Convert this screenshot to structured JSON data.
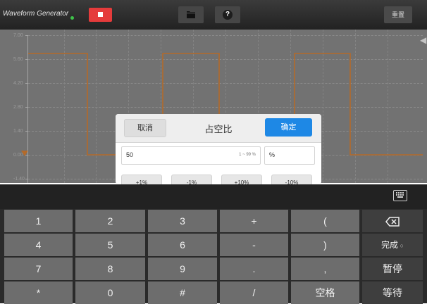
{
  "toolbar": {
    "app_title": "Waveform Generator",
    "reset_label": "重置",
    "icons": {
      "stop": "stop-icon",
      "folder": "folder-icon",
      "help": "help-icon"
    },
    "colors": {
      "stop_button": "#e53b3b",
      "status_dot": "#3fc24a"
    }
  },
  "plot": {
    "y_tick_labels": [
      "7.00",
      "5.60",
      "4.20",
      "2.80",
      "1.40",
      "0.00",
      "-1.40"
    ],
    "waveform_color": "#b36a2a",
    "marker_icon": "trigger-marker-icon",
    "right_icon": "arrow-left-icon"
  },
  "dialog": {
    "cancel_label": "取消",
    "title": "占空比",
    "confirm_label": "确定",
    "value": "50",
    "range": "1 ~ 99 %",
    "unit": "%",
    "step_buttons": [
      "+1%",
      "-1%",
      "+10%",
      "-10%"
    ],
    "accent_color": "#1e88e5"
  },
  "keyboard": {
    "hide_icon": "keyboard-hide-icon",
    "backspace_icon": "backspace-icon",
    "keys": [
      [
        "1",
        "2",
        "3",
        "+",
        "("
      ],
      [
        "4",
        "5",
        "6",
        "-",
        ")"
      ],
      [
        "7",
        "8",
        "9",
        ".",
        ","
      ],
      [
        "*",
        "0",
        "#",
        "/",
        "空格"
      ]
    ],
    "side_keys": {
      "done": "完成",
      "pause": "暂停",
      "wait": "等待"
    }
  }
}
